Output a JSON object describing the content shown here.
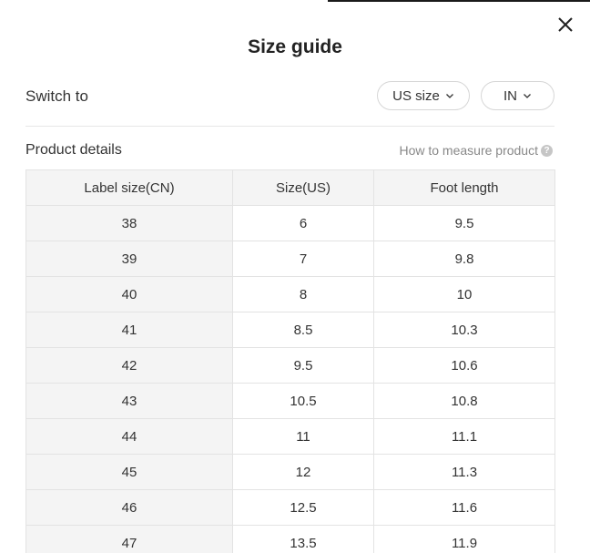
{
  "title": "Size guide",
  "switch": {
    "label": "Switch to",
    "size_system": "US size",
    "unit": "IN"
  },
  "details": {
    "label": "Product details",
    "measure_link": "How to measure product"
  },
  "table": {
    "headers": [
      "Label size(CN)",
      "Size(US)",
      "Foot length"
    ],
    "rows": [
      [
        "38",
        "6",
        "9.5"
      ],
      [
        "39",
        "7",
        "9.8"
      ],
      [
        "40",
        "8",
        "10"
      ],
      [
        "41",
        "8.5",
        "10.3"
      ],
      [
        "42",
        "9.5",
        "10.6"
      ],
      [
        "43",
        "10.5",
        "10.8"
      ],
      [
        "44",
        "11",
        "11.1"
      ],
      [
        "45",
        "12",
        "11.3"
      ],
      [
        "46",
        "12.5",
        "11.6"
      ],
      [
        "47",
        "13.5",
        "11.9"
      ]
    ]
  }
}
